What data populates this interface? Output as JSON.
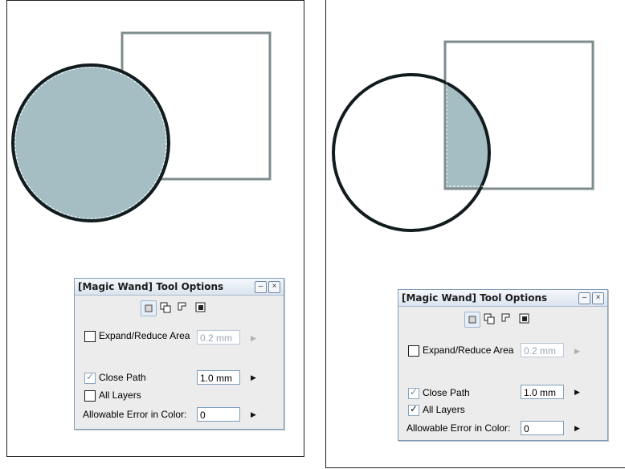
{
  "colors": {
    "selection_fill": "#a4bec4",
    "circle_stroke": "#121c1f",
    "square_stroke": "#7f8c8e",
    "panel_bg": "#ececec",
    "panel_border": "#7f9db9"
  },
  "panels": [
    {
      "title": "[Magic Wand] Tool Options",
      "modes": [
        "new-selection-icon",
        "add-selection-icon",
        "subtract-selection-icon",
        "intersect-selection-icon"
      ],
      "expand_reduce": {
        "label": "Expand/Reduce Area",
        "checked": false,
        "value": "0.2 mm",
        "enabled": false
      },
      "close_path": {
        "label": "Close Path",
        "checked": true,
        "value": "1.0 mm"
      },
      "all_layers": {
        "label": "All Layers",
        "checked": false
      },
      "allowable_error": {
        "label": "Allowable Error in Color:",
        "value": "0"
      }
    },
    {
      "title": "[Magic Wand] Tool Options",
      "modes": [
        "new-selection-icon",
        "add-selection-icon",
        "subtract-selection-icon",
        "intersect-selection-icon"
      ],
      "expand_reduce": {
        "label": "Expand/Reduce Area",
        "checked": false,
        "value": "0.2 mm",
        "enabled": false
      },
      "close_path": {
        "label": "Close Path",
        "checked": true,
        "value": "1.0 mm"
      },
      "all_layers": {
        "label": "All Layers",
        "checked": true
      },
      "allowable_error": {
        "label": "Allowable Error in Color:",
        "value": "0"
      }
    }
  ]
}
